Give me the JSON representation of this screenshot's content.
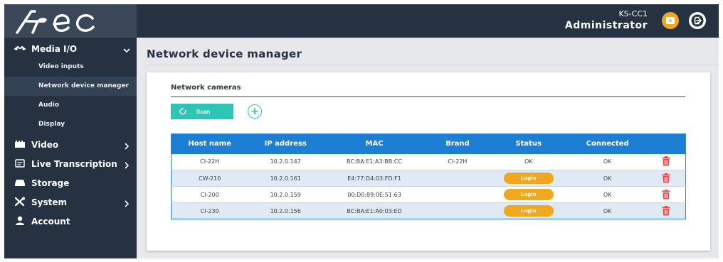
{
  "app": {
    "logo_text": "Arec"
  },
  "header": {
    "device_name": "KS-CC1",
    "role": "Administrator",
    "player_icon": "player-icon",
    "logout_icon": "logout-icon",
    "accent_color": "#f0a81e"
  },
  "sidebar": {
    "items": [
      {
        "label": "Media I/O",
        "icon": "media-io-icon",
        "expanded": true
      },
      {
        "label": "Video",
        "icon": "video-icon"
      },
      {
        "label": "Live Transcription",
        "icon": "transcription-icon"
      },
      {
        "label": "Storage",
        "icon": "storage-icon"
      },
      {
        "label": "System",
        "icon": "system-tools-icon"
      },
      {
        "label": "Account",
        "icon": "account-icon"
      }
    ],
    "sub_items": [
      {
        "label": "Video inputs"
      },
      {
        "label": "Network device manager",
        "active": true
      },
      {
        "label": "Audio"
      },
      {
        "label": "Display"
      }
    ]
  },
  "main": {
    "page_title": "Network device manager",
    "section_title": "Network cameras",
    "scan_label": "Scan",
    "add_label": "+",
    "table": {
      "columns": [
        "Host name",
        "IP address",
        "MAC",
        "Brand",
        "Status",
        "Connected"
      ],
      "rows": [
        {
          "host": "CI-22H",
          "ip": "10.2.0.147",
          "mac": "BC:BA:E1:A3:BB:CC",
          "brand": "CI-22H",
          "status": "OK",
          "connected": "OK"
        },
        {
          "host": "CW-210",
          "ip": "10.2.0.161",
          "mac": "E4:77:D4:03:FD:F1",
          "brand": "",
          "status": "Login",
          "connected": "OK"
        },
        {
          "host": "CI-200",
          "ip": "10.2.0.159",
          "mac": "00:D0:89:0E:51:63",
          "brand": "",
          "status": "Login",
          "connected": "OK"
        },
        {
          "host": "CI-230",
          "ip": "10.2.0.156",
          "mac": "BC:BA:E1:A0:03:ED",
          "brand": "",
          "status": "Login",
          "connected": "OK"
        }
      ]
    },
    "colors": {
      "header_bg": "#263241",
      "table_header": "#1d7fd4",
      "scan_button": "#2ec4b6",
      "login_button": "#f0a81e",
      "delete_icon": "#e84a4a"
    }
  }
}
